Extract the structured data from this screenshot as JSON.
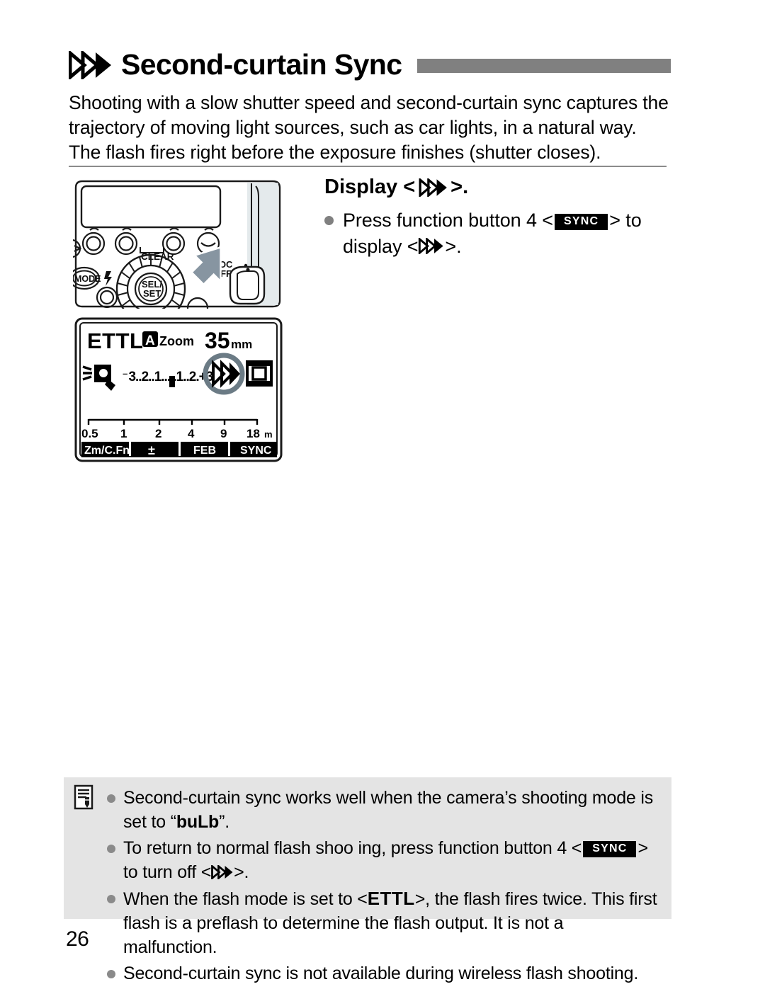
{
  "page": {
    "number": "26",
    "title": "Second-curtain Sync",
    "title_icon": "second-curtain-sync-icon",
    "accent_bar_color": "#808080",
    "note_box_color": "#e4e4e4"
  },
  "intro": {
    "text": "Shooting with a slow shutter speed and second-curtain sync captures the trajectory of moving light sources, such as car lights, in a natural way. The flash fires right before the exposure finishes (shutter closes)."
  },
  "figures": {
    "flash_unit": {
      "caption": "",
      "labels": {
        "clear": "CLEAR",
        "mode": "MODE",
        "sel_set_top": "SEL/",
        "sel_set_bottom": "SET",
        "lock": "LOC",
        "off": "OFF",
        "flash_symbol": "⚡"
      },
      "arrow_color": "#8795a1"
    },
    "lcd": {
      "mode": "ETTL",
      "zoom_auto_badge": "A",
      "zoom_label": "Zoom",
      "focal_length": "35",
      "focal_unit": "mm",
      "compensation_scale": "-3..2..1..▮..1..2.+3",
      "distance_ticks": [
        "0.5",
        "1",
        "2",
        "4",
        "9",
        "18"
      ],
      "distance_unit": "m",
      "soft_buttons": [
        "Zm/C.Fn",
        "±",
        "FEB",
        "SYNC"
      ],
      "highlight_icon": "second-curtain-sync-icon",
      "film-frame-icon": "film-frame-icon",
      "bounce_icon": "flash-head-icon",
      "highlight_ring_color": "#6b7b85"
    }
  },
  "display_section": {
    "heading_prefix": "Display <",
    "heading_suffix": ">.",
    "bullet": {
      "part1": "Press function button 4 <",
      "badge": "SYNC",
      "part2": "> to display <",
      "part3": ">."
    }
  },
  "notes": {
    "icon": "note-pencil-icon",
    "items": [
      {
        "segments": [
          {
            "type": "text",
            "value": "Second-curtain sync works well when the camera’s shooting mode is set to “"
          },
          {
            "type": "bold",
            "value": "buLb"
          },
          {
            "type": "text",
            "value": "”."
          }
        ]
      },
      {
        "segments": [
          {
            "type": "text",
            "value": "To return to normal flash shoo ing, press function button 4 <"
          },
          {
            "type": "badge",
            "value": "SYNC"
          },
          {
            "type": "text",
            "value": "> to turn off <"
          },
          {
            "type": "sc-icon",
            "value": ""
          },
          {
            "type": "text",
            "value": ">."
          }
        ]
      },
      {
        "segments": [
          {
            "type": "text",
            "value": "When the flash mode is set to <"
          },
          {
            "type": "ettl",
            "value": "ETTL"
          },
          {
            "type": "text",
            "value": ">, the flash fires twice. This first flash is a preflash to determine the flash output. It is not a malfunction."
          }
        ]
      },
      {
        "segments": [
          {
            "type": "text",
            "value": "Second-curtain sync is not available during wireless flash shooting."
          }
        ]
      }
    ]
  }
}
